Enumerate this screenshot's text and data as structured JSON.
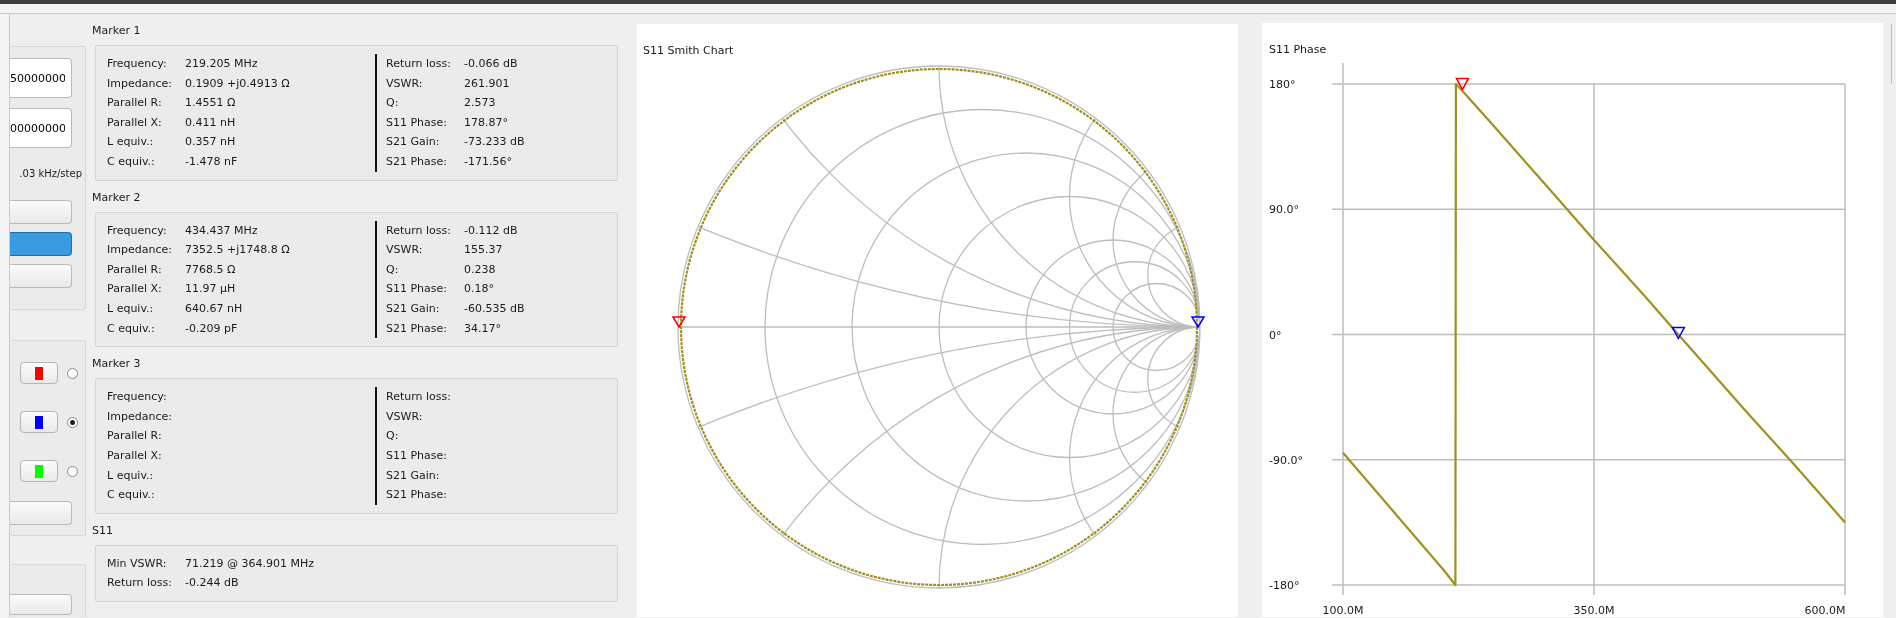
{
  "controls": {
    "inputs": [
      {
        "value": "50000000"
      },
      {
        "value": "00000000"
      }
    ],
    "step_label": ".03 kHz/step",
    "buttons": [
      {
        "pressed": false
      },
      {
        "pressed": true
      },
      {
        "pressed": false
      }
    ],
    "marker_buttons": [
      {
        "color": "#ff0000",
        "selected": false
      },
      {
        "color": "#0000ff",
        "selected": true
      },
      {
        "color": "#00ff00",
        "selected": false
      }
    ]
  },
  "markers": [
    {
      "title": "Marker 1",
      "left": [
        {
          "label": "Frequency:",
          "value": "219.205 MHz"
        },
        {
          "label": "Impedance:",
          "value": "0.1909 +j0.4913 Ω"
        },
        {
          "label": "Parallel R:",
          "value": "1.4551 Ω"
        },
        {
          "label": "Parallel X:",
          "value": "0.411 nH"
        },
        {
          "label": "L equiv.:",
          "value": "0.357 nH"
        },
        {
          "label": "C equiv.:",
          "value": "-1.478 nF"
        }
      ],
      "right": [
        {
          "label": "Return loss:",
          "value": "-0.066 dB"
        },
        {
          "label": "VSWR:",
          "value": "261.901"
        },
        {
          "label": "Q:",
          "value": "2.573"
        },
        {
          "label": "S11 Phase:",
          "value": "178.87°"
        },
        {
          "label": "S21 Gain:",
          "value": "-73.233 dB"
        },
        {
          "label": "S21 Phase:",
          "value": "-171.56°"
        }
      ]
    },
    {
      "title": "Marker 2",
      "left": [
        {
          "label": "Frequency:",
          "value": "434.437 MHz"
        },
        {
          "label": "Impedance:",
          "value": "7352.5 +j1748.8 Ω"
        },
        {
          "label": "Parallel R:",
          "value": "7768.5 Ω"
        },
        {
          "label": "Parallel X:",
          "value": "11.97 µH"
        },
        {
          "label": "L equiv.:",
          "value": "640.67 nH"
        },
        {
          "label": "C equiv.:",
          "value": "-0.209 pF"
        }
      ],
      "right": [
        {
          "label": "Return loss:",
          "value": "-0.112 dB"
        },
        {
          "label": "VSWR:",
          "value": "155.37"
        },
        {
          "label": "Q:",
          "value": "0.238"
        },
        {
          "label": "S11 Phase:",
          "value": "0.18°"
        },
        {
          "label": "S21 Gain:",
          "value": "-60.535 dB"
        },
        {
          "label": "S21 Phase:",
          "value": "34.17°"
        }
      ]
    },
    {
      "title": "Marker 3",
      "left": [
        {
          "label": "Frequency:"
        },
        {
          "label": "Impedance:"
        },
        {
          "label": "Parallel R:"
        },
        {
          "label": "Parallel X:"
        },
        {
          "label": "L equiv.:"
        },
        {
          "label": "C equiv.:"
        }
      ],
      "right": [
        {
          "label": "Return loss:"
        },
        {
          "label": "VSWR:"
        },
        {
          "label": "Q:"
        },
        {
          "label": "S11 Phase:"
        },
        {
          "label": "S21 Gain:"
        },
        {
          "label": "S21 Phase:"
        }
      ]
    }
  ],
  "s11": {
    "title": "S11",
    "rows": [
      {
        "label": "Min VSWR:",
        "value": "71.219 @ 364.901 MHz"
      },
      {
        "label": "Return loss:",
        "value": "-0.244 dB"
      }
    ]
  },
  "smith_chart": {
    "title": "S11 Smith Chart"
  },
  "phase_chart": {
    "title": "S11 Phase",
    "chart_data": {
      "type": "line",
      "x": [
        100,
        150,
        200,
        212,
        212.5,
        219,
        250,
        300,
        350,
        400,
        434,
        500,
        550,
        600
      ],
      "series": [
        {
          "color": "#a0901e",
          "values": [
            -85,
            -127,
            -169,
            -180,
            180,
            175,
            150,
            109,
            68,
            28,
            0,
            -54,
            -94,
            -135
          ]
        },
        {
          "color": "#ff0000",
          "marker": "triangle",
          "values": [
            null,
            null,
            null,
            null,
            null,
            179,
            null,
            null,
            null,
            null,
            null,
            null,
            null,
            null
          ]
        },
        {
          "color": "#0000ff",
          "marker": "triangle",
          "values": [
            null,
            null,
            null,
            null,
            null,
            null,
            null,
            null,
            null,
            null,
            0,
            null,
            null,
            null
          ]
        }
      ],
      "grid": true,
      "xlim": [
        100,
        600
      ],
      "ylim": [
        -180,
        180
      ],
      "xticks": [
        {
          "value": 100,
          "label": "100.0M"
        },
        {
          "value": 350,
          "label": "350.0M"
        },
        {
          "value": 600,
          "label": "600.0M"
        }
      ],
      "yticks": [
        {
          "value": 180,
          "label": "180°"
        },
        {
          "value": 90,
          "label": "90.0°"
        },
        {
          "value": 0,
          "label": "0°"
        },
        {
          "value": -90,
          "label": "-90.0°"
        },
        {
          "value": -180,
          "label": "-180°"
        }
      ]
    }
  }
}
